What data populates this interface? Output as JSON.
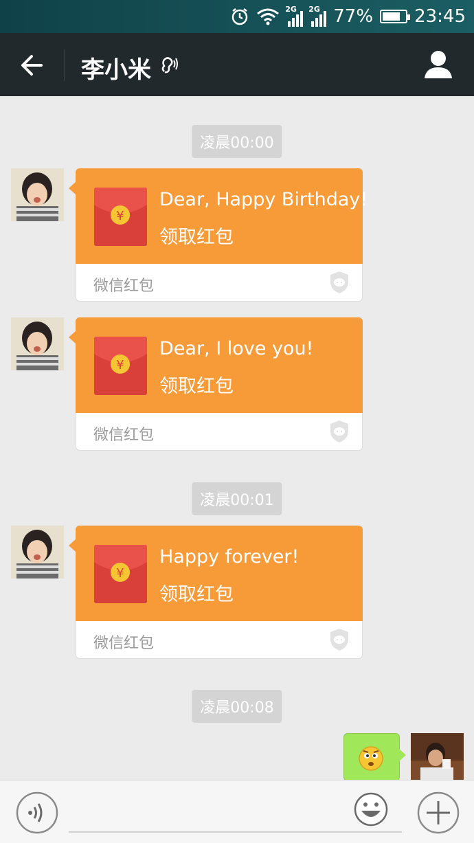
{
  "status_bar": {
    "network_1": "2G",
    "network_2": "2G",
    "battery_percent": "77%",
    "battery_level": 0.77,
    "time": "23:45"
  },
  "header": {
    "title": "李小米"
  },
  "messages": [
    {
      "timestamp": "凌晨00:00",
      "text": "Dear, Happy Birthday!",
      "action": "领取红包",
      "brand": "微信红包"
    },
    {
      "text": "Dear, I love you!",
      "action": "领取红包",
      "brand": "微信红包"
    },
    {
      "timestamp": "凌晨00:01",
      "text": "Happy forever!",
      "action": "领取红包",
      "brand": "微信红包"
    },
    {
      "timestamp": "凌晨00:08"
    }
  ],
  "colors": {
    "status_bar": "#165257",
    "title_bar": "#22292c",
    "chat_bg": "#ebebeb",
    "red_packet": "#f79a38",
    "envelope": "#d9403a",
    "coin": "#f5c534",
    "my_bubble": "#a0e75a"
  },
  "icons": [
    "alarm-icon",
    "wifi-icon",
    "signal-icon",
    "battery-icon",
    "back-arrow-icon",
    "ear-icon",
    "profile-icon",
    "red-envelope-icon",
    "shield-icon",
    "emoji-icon",
    "voice-icon",
    "smiley-icon",
    "plus-icon"
  ]
}
